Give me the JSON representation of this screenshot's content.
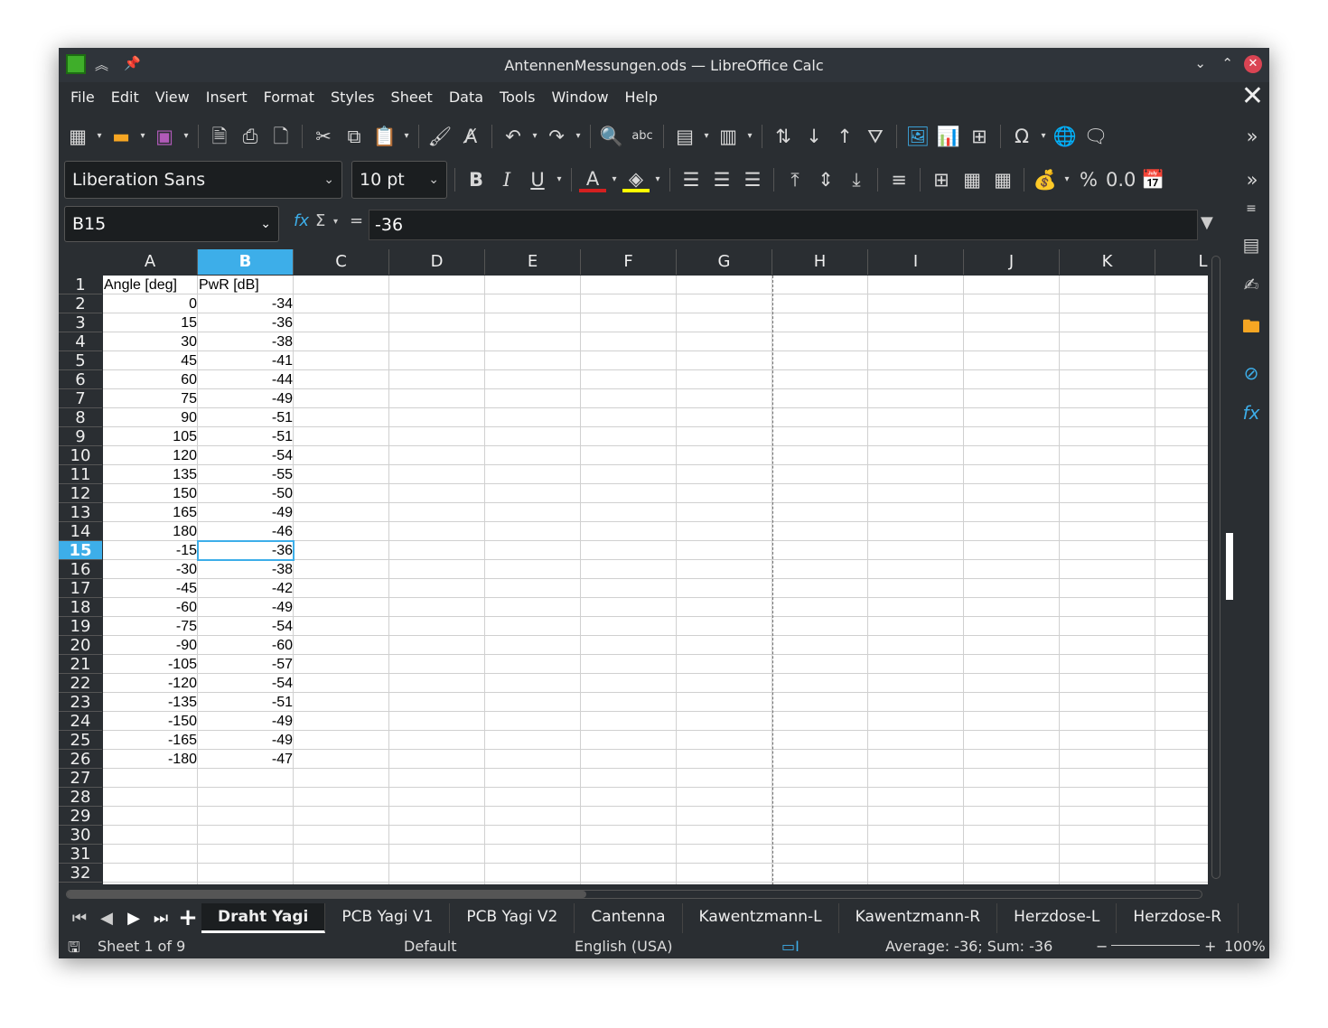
{
  "window": {
    "title": "AntennenMessungen.ods — LibreOffice Calc"
  },
  "menu": [
    "File",
    "Edit",
    "View",
    "Insert",
    "Format",
    "Styles",
    "Sheet",
    "Data",
    "Tools",
    "Window",
    "Help"
  ],
  "toolbar2": {
    "font_name": "Liberation Sans",
    "font_size": "10 pt"
  },
  "formula": {
    "cell_ref": "B15",
    "value": "-36",
    "fx": "fx",
    "sum": "Σ",
    "eq": "="
  },
  "columns": [
    "A",
    "B",
    "C",
    "D",
    "E",
    "F",
    "G",
    "H",
    "I",
    "J",
    "K",
    "L"
  ],
  "selected_column": "B",
  "selected_row": 15,
  "rows": [
    [
      "Angle [deg]",
      "PwR [dB]"
    ],
    [
      "0",
      "-34"
    ],
    [
      "15",
      "-36"
    ],
    [
      "30",
      "-38"
    ],
    [
      "45",
      "-41"
    ],
    [
      "60",
      "-44"
    ],
    [
      "75",
      "-49"
    ],
    [
      "90",
      "-51"
    ],
    [
      "105",
      "-51"
    ],
    [
      "120",
      "-54"
    ],
    [
      "135",
      "-55"
    ],
    [
      "150",
      "-50"
    ],
    [
      "165",
      "-49"
    ],
    [
      "180",
      "-46"
    ],
    [
      "-15",
      "-36"
    ],
    [
      "-30",
      "-38"
    ],
    [
      "-45",
      "-42"
    ],
    [
      "-60",
      "-49"
    ],
    [
      "-75",
      "-54"
    ],
    [
      "-90",
      "-60"
    ],
    [
      "-105",
      "-57"
    ],
    [
      "-120",
      "-54"
    ],
    [
      "-135",
      "-51"
    ],
    [
      "-150",
      "-49"
    ],
    [
      "-165",
      "-49"
    ],
    [
      "-180",
      "-47"
    ]
  ],
  "row_count": 32,
  "sheets": [
    "Draht Yagi",
    "PCB Yagi V1",
    "PCB Yagi V2",
    "Cantenna",
    "Kawentzmann-L",
    "Kawentzmann-R",
    "Herzdose-L",
    "Herzdose-R"
  ],
  "active_sheet": 0,
  "status": {
    "sheet": "Sheet 1 of 9",
    "style": "Default",
    "language": "English (USA)",
    "selection": "Average: -36; Sum: -36",
    "zoom": "100%"
  },
  "colors": {
    "accent": "#3daee9",
    "window_bg": "#2a2e32",
    "close": "#da4453"
  }
}
